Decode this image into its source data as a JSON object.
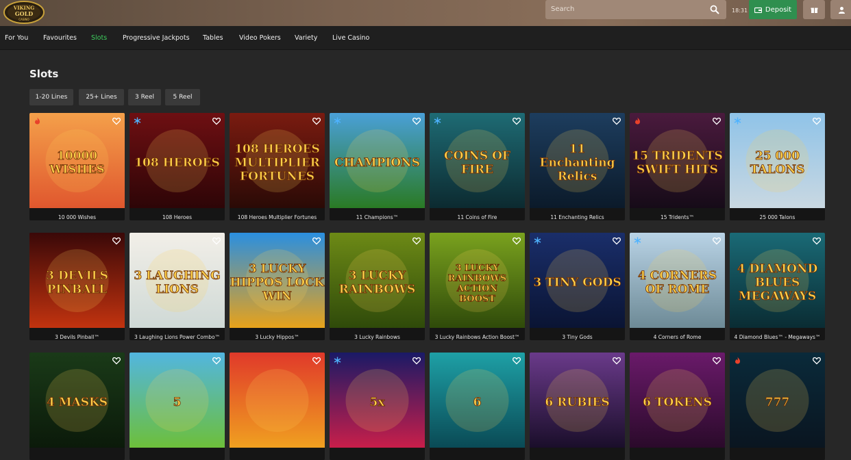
{
  "header": {
    "logo_text": "VIKING GOLD CASINO",
    "search_placeholder": "Search",
    "time": "18:31",
    "deposit_label": "Deposit",
    "icons": [
      "search-icon",
      "wallet-icon",
      "gift-icon",
      "user-icon"
    ]
  },
  "nav": {
    "items": [
      {
        "label": "For You",
        "active": false
      },
      {
        "label": "Favourites",
        "active": false
      },
      {
        "label": "Slots",
        "active": true
      },
      {
        "label": "Progressive Jackpots",
        "active": false
      },
      {
        "label": "Tables",
        "active": false
      },
      {
        "label": "Video Pokers",
        "active": false
      },
      {
        "label": "Variety",
        "active": false
      },
      {
        "label": "Live Casino",
        "active": false
      }
    ]
  },
  "page": {
    "title": "Slots",
    "filters": [
      "1-20 Lines",
      "25+ Lines",
      "3 Reel",
      "5 Reel"
    ]
  },
  "games": {
    "row1": [
      {
        "name": "10 000 Wishes",
        "art": "10000 WISHES",
        "badge": "flame",
        "bg1": "#f4a04a",
        "bg2": "#e0572e"
      },
      {
        "name": "108 Heroes",
        "art": "108 HEROES",
        "badge": "snowflake",
        "bg1": "#6e0f12",
        "bg2": "#2d0507"
      },
      {
        "name": "108 Heroes Multiplier Fortunes",
        "art": "108 HEROES MULTIPLIER FORTUNES",
        "badge": "",
        "bg1": "#7a1b10",
        "bg2": "#2a0a06"
      },
      {
        "name": "11 Champions™",
        "art": "CHAMPIONS",
        "badge": "snowflake",
        "bg1": "#4aa0d8",
        "bg2": "#2a7a24"
      },
      {
        "name": "11 Coins of Fire",
        "art": "COINS OF FIRE",
        "badge": "snowflake",
        "bg1": "#1e6b74",
        "bg2": "#0c2a30"
      },
      {
        "name": "11 Enchanting Relics",
        "art": "11 Enchanting Relics",
        "badge": "",
        "bg1": "#1d3d5e",
        "bg2": "#0b1a2a"
      },
      {
        "name": "15 Tridents™",
        "art": "15 TRIDENTS SWIFT HITS",
        "badge": "flame",
        "bg1": "#4a1a3d",
        "bg2": "#160b18"
      },
      {
        "name": "25 000 Talons",
        "art": "25 000 TALONS",
        "badge": "snowflake",
        "bg1": "#8fc3e8",
        "bg2": "#c9d8e2"
      }
    ],
    "row2": [
      {
        "name": "3 Devils Pinball™",
        "art": "3 DEVILS PINBALL",
        "badge": "",
        "bg1": "#3a0808",
        "bg2": "#c2330f"
      },
      {
        "name": "3 Laughing Lions Power Combo™",
        "art": "3 LAUGHING LIONS",
        "badge": "",
        "bg1": "#f2efe8",
        "bg2": "#cfd9d6"
      },
      {
        "name": "3 Lucky Hippos™",
        "art": "3 LUCKY HIPPOS LOCK WIN",
        "badge": "",
        "bg1": "#2a8fe0",
        "bg2": "#e8a21a"
      },
      {
        "name": "3 Lucky Rainbows",
        "art": "3 LUCKY RAINBOWS",
        "badge": "",
        "bg1": "#6d8a16",
        "bg2": "#2f4a0a"
      },
      {
        "name": "3 Lucky Rainbows Action Boost™",
        "art": "3 LUCKY RAINBOWS ACTION BOOST",
        "badge": "",
        "bg1": "#7aa21e",
        "bg2": "#2f4a0a"
      },
      {
        "name": "3 Tiny Gods",
        "art": "3 TINY GODS",
        "badge": "snowflake",
        "bg1": "#1a2e6a",
        "bg2": "#0a1433"
      },
      {
        "name": "4 Corners of Rome",
        "art": "4 CORNERS OF ROME",
        "badge": "snowflake",
        "bg1": "#b9d3e6",
        "bg2": "#6d8a96"
      },
      {
        "name": "4 Diamond Blues™ - Megaways™",
        "art": "4 DIAMOND BLUES MEGAWAYS",
        "badge": "",
        "bg1": "#1a6a76",
        "bg2": "#0a2c33"
      }
    ],
    "row3": [
      {
        "name": "",
        "art": "4 MASKS",
        "badge": "",
        "bg1": "#1a3a18",
        "bg2": "#0b1a0a"
      },
      {
        "name": "",
        "art": "5",
        "badge": "",
        "bg1": "#52b6e0",
        "bg2": "#6dbf3a"
      },
      {
        "name": "",
        "art": "",
        "badge": "",
        "bg1": "#e0392a",
        "bg2": "#f0a020"
      },
      {
        "name": "",
        "art": "5x",
        "badge": "snowflake",
        "bg1": "#1a1a66",
        "bg2": "#c81e4a"
      },
      {
        "name": "",
        "art": "6",
        "badge": "",
        "bg1": "#1ea0a6",
        "bg2": "#0a4a55"
      },
      {
        "name": "",
        "art": "6 RUBIES",
        "badge": "",
        "bg1": "#6a3a8a",
        "bg2": "#1a0e2a"
      },
      {
        "name": "",
        "art": "6 TOKENS",
        "badge": "",
        "bg1": "#6a1a6a",
        "bg2": "#2a0a2a"
      },
      {
        "name": "",
        "art": "777",
        "badge": "flame",
        "bg1": "#0a2a3a",
        "bg2": "#0a1520"
      }
    ]
  }
}
